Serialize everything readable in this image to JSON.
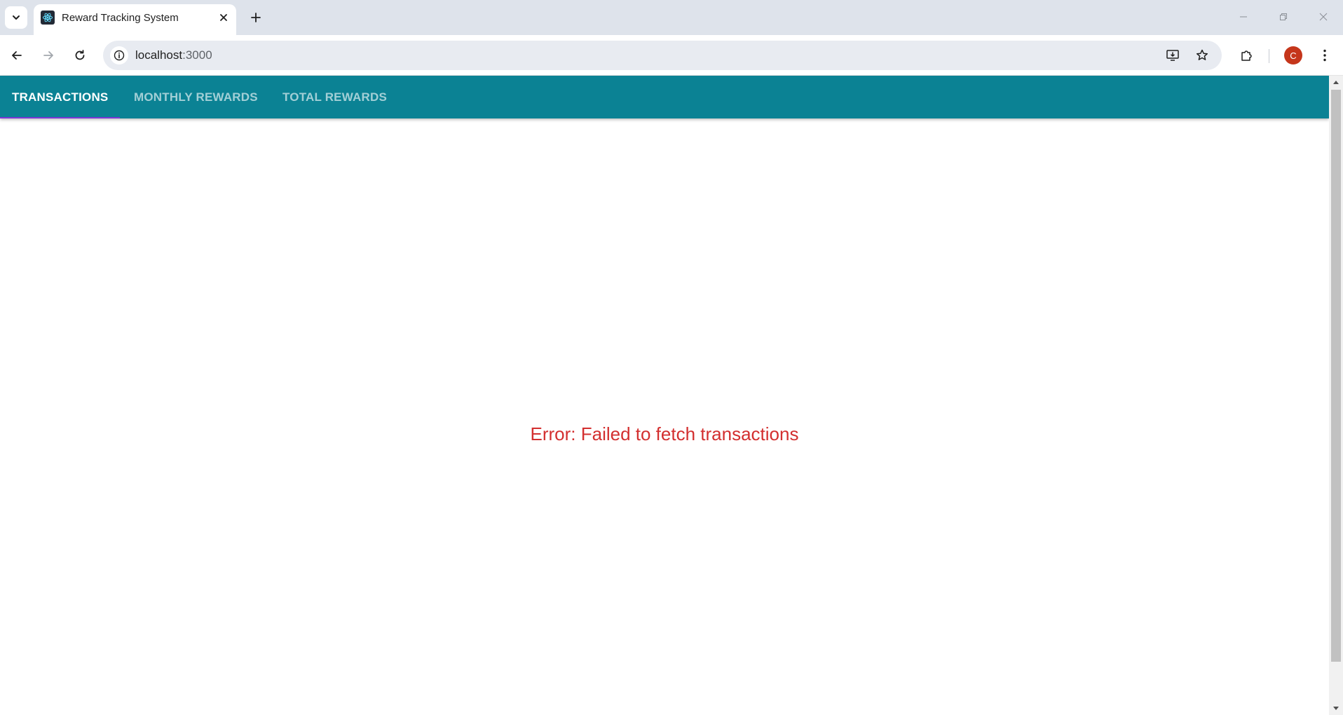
{
  "browser": {
    "tab_title": "Reward Tracking System",
    "url_host": "localhost",
    "url_port": ":3000",
    "profile_initial": "C"
  },
  "app": {
    "tabs": [
      {
        "label": "TRANSACTIONS",
        "active": true
      },
      {
        "label": "MONTHLY REWARDS",
        "active": false
      },
      {
        "label": "TOTAL REWARDS",
        "active": false
      }
    ],
    "error_message": "Error: Failed to fetch transactions"
  },
  "colors": {
    "app_bar": "#0b8294",
    "tab_indicator": "#7b35d6",
    "error_text": "#d32f2f",
    "profile_avatar": "#c5361b"
  },
  "icons": {
    "tab_search": "chevron-down-icon",
    "favicon": "react-logo-icon",
    "tab_close": "close-icon",
    "new_tab": "plus-icon",
    "back": "arrow-left-icon",
    "forward": "arrow-right-icon",
    "reload": "reload-icon",
    "site_info": "info-icon",
    "install_app": "install-app-icon",
    "bookmark": "star-icon",
    "extensions": "puzzle-icon",
    "menu": "kebab-menu-icon"
  }
}
